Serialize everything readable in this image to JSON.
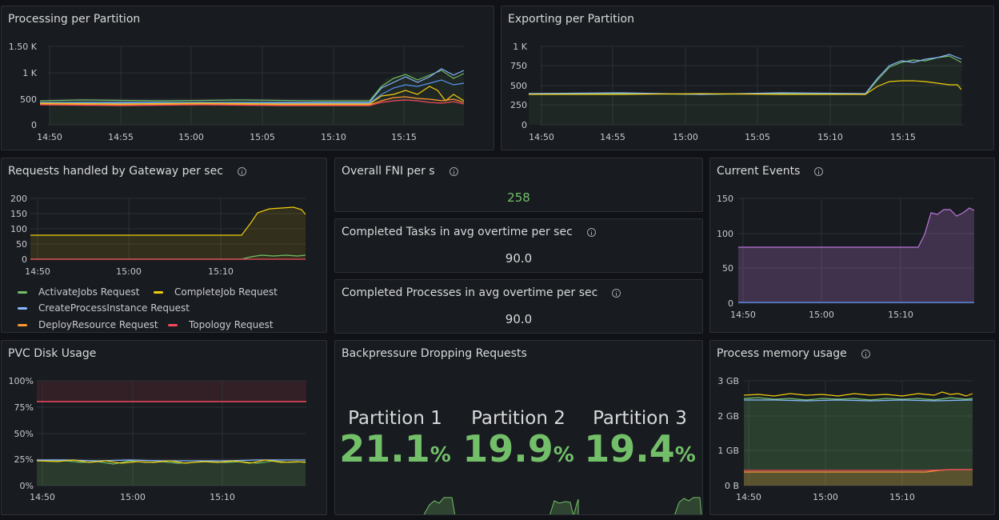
{
  "colors": {
    "green": "#73bf69",
    "yellow": "#f2cc0c",
    "blue": "#5794f2",
    "cyan": "#8ab8ff",
    "orange": "#ff9830",
    "red": "#f2495c",
    "purple": "#b877d9"
  },
  "processing": {
    "title": "Processing per Partition",
    "y_ticks": [
      "1.50 K",
      "1 K",
      "500",
      "0"
    ],
    "x_ticks": [
      "14:50",
      "14:55",
      "15:00",
      "15:05",
      "15:10",
      "15:15"
    ]
  },
  "exporting": {
    "title": "Exporting per Partition",
    "y_ticks": [
      "1 K",
      "750",
      "500",
      "250",
      "0"
    ],
    "x_ticks": [
      "14:50",
      "14:55",
      "15:00",
      "15:05",
      "15:10",
      "15:15"
    ]
  },
  "gateway": {
    "title": "Requests handled by Gateway per sec",
    "y_ticks": [
      "200",
      "150",
      "100",
      "50",
      "0"
    ],
    "x_ticks": [
      "14:50",
      "15:00",
      "15:10"
    ],
    "legend": [
      "ActivateJobs Request",
      "CompleteJob Request",
      "CreateProcessInstance Request",
      "DeployResource Request",
      "Topology Request"
    ]
  },
  "fni": {
    "title": "Overall FNI per s",
    "value": "258"
  },
  "tasks": {
    "title": "Completed Tasks in avg overtime per sec",
    "value": "90.0"
  },
  "processes": {
    "title": "Completed Processes in avg overtime per sec",
    "value": "90.0"
  },
  "events": {
    "title": "Current Events",
    "y_ticks": [
      "150",
      "100",
      "50",
      "0"
    ],
    "x_ticks": [
      "14:50",
      "15:00",
      "15:10"
    ]
  },
  "pvc": {
    "title": "PVC Disk Usage",
    "y_ticks": [
      "100%",
      "75%",
      "50%",
      "25%",
      "0%"
    ],
    "x_ticks": [
      "14:50",
      "15:00",
      "15:10"
    ]
  },
  "backpressure": {
    "title": "Backpressure Dropping Requests",
    "partitions": [
      {
        "label": "Partition 1",
        "value": "21.1",
        "unit": "%"
      },
      {
        "label": "Partition 2",
        "value": "19.9",
        "unit": "%"
      },
      {
        "label": "Partition 3",
        "value": "19.4",
        "unit": "%"
      }
    ]
  },
  "memory": {
    "title": "Process memory usage",
    "y_ticks": [
      "3 GB",
      "2 GB",
      "1 GB",
      "0 B"
    ],
    "x_ticks": [
      "14:50",
      "15:00",
      "15:10"
    ]
  }
}
